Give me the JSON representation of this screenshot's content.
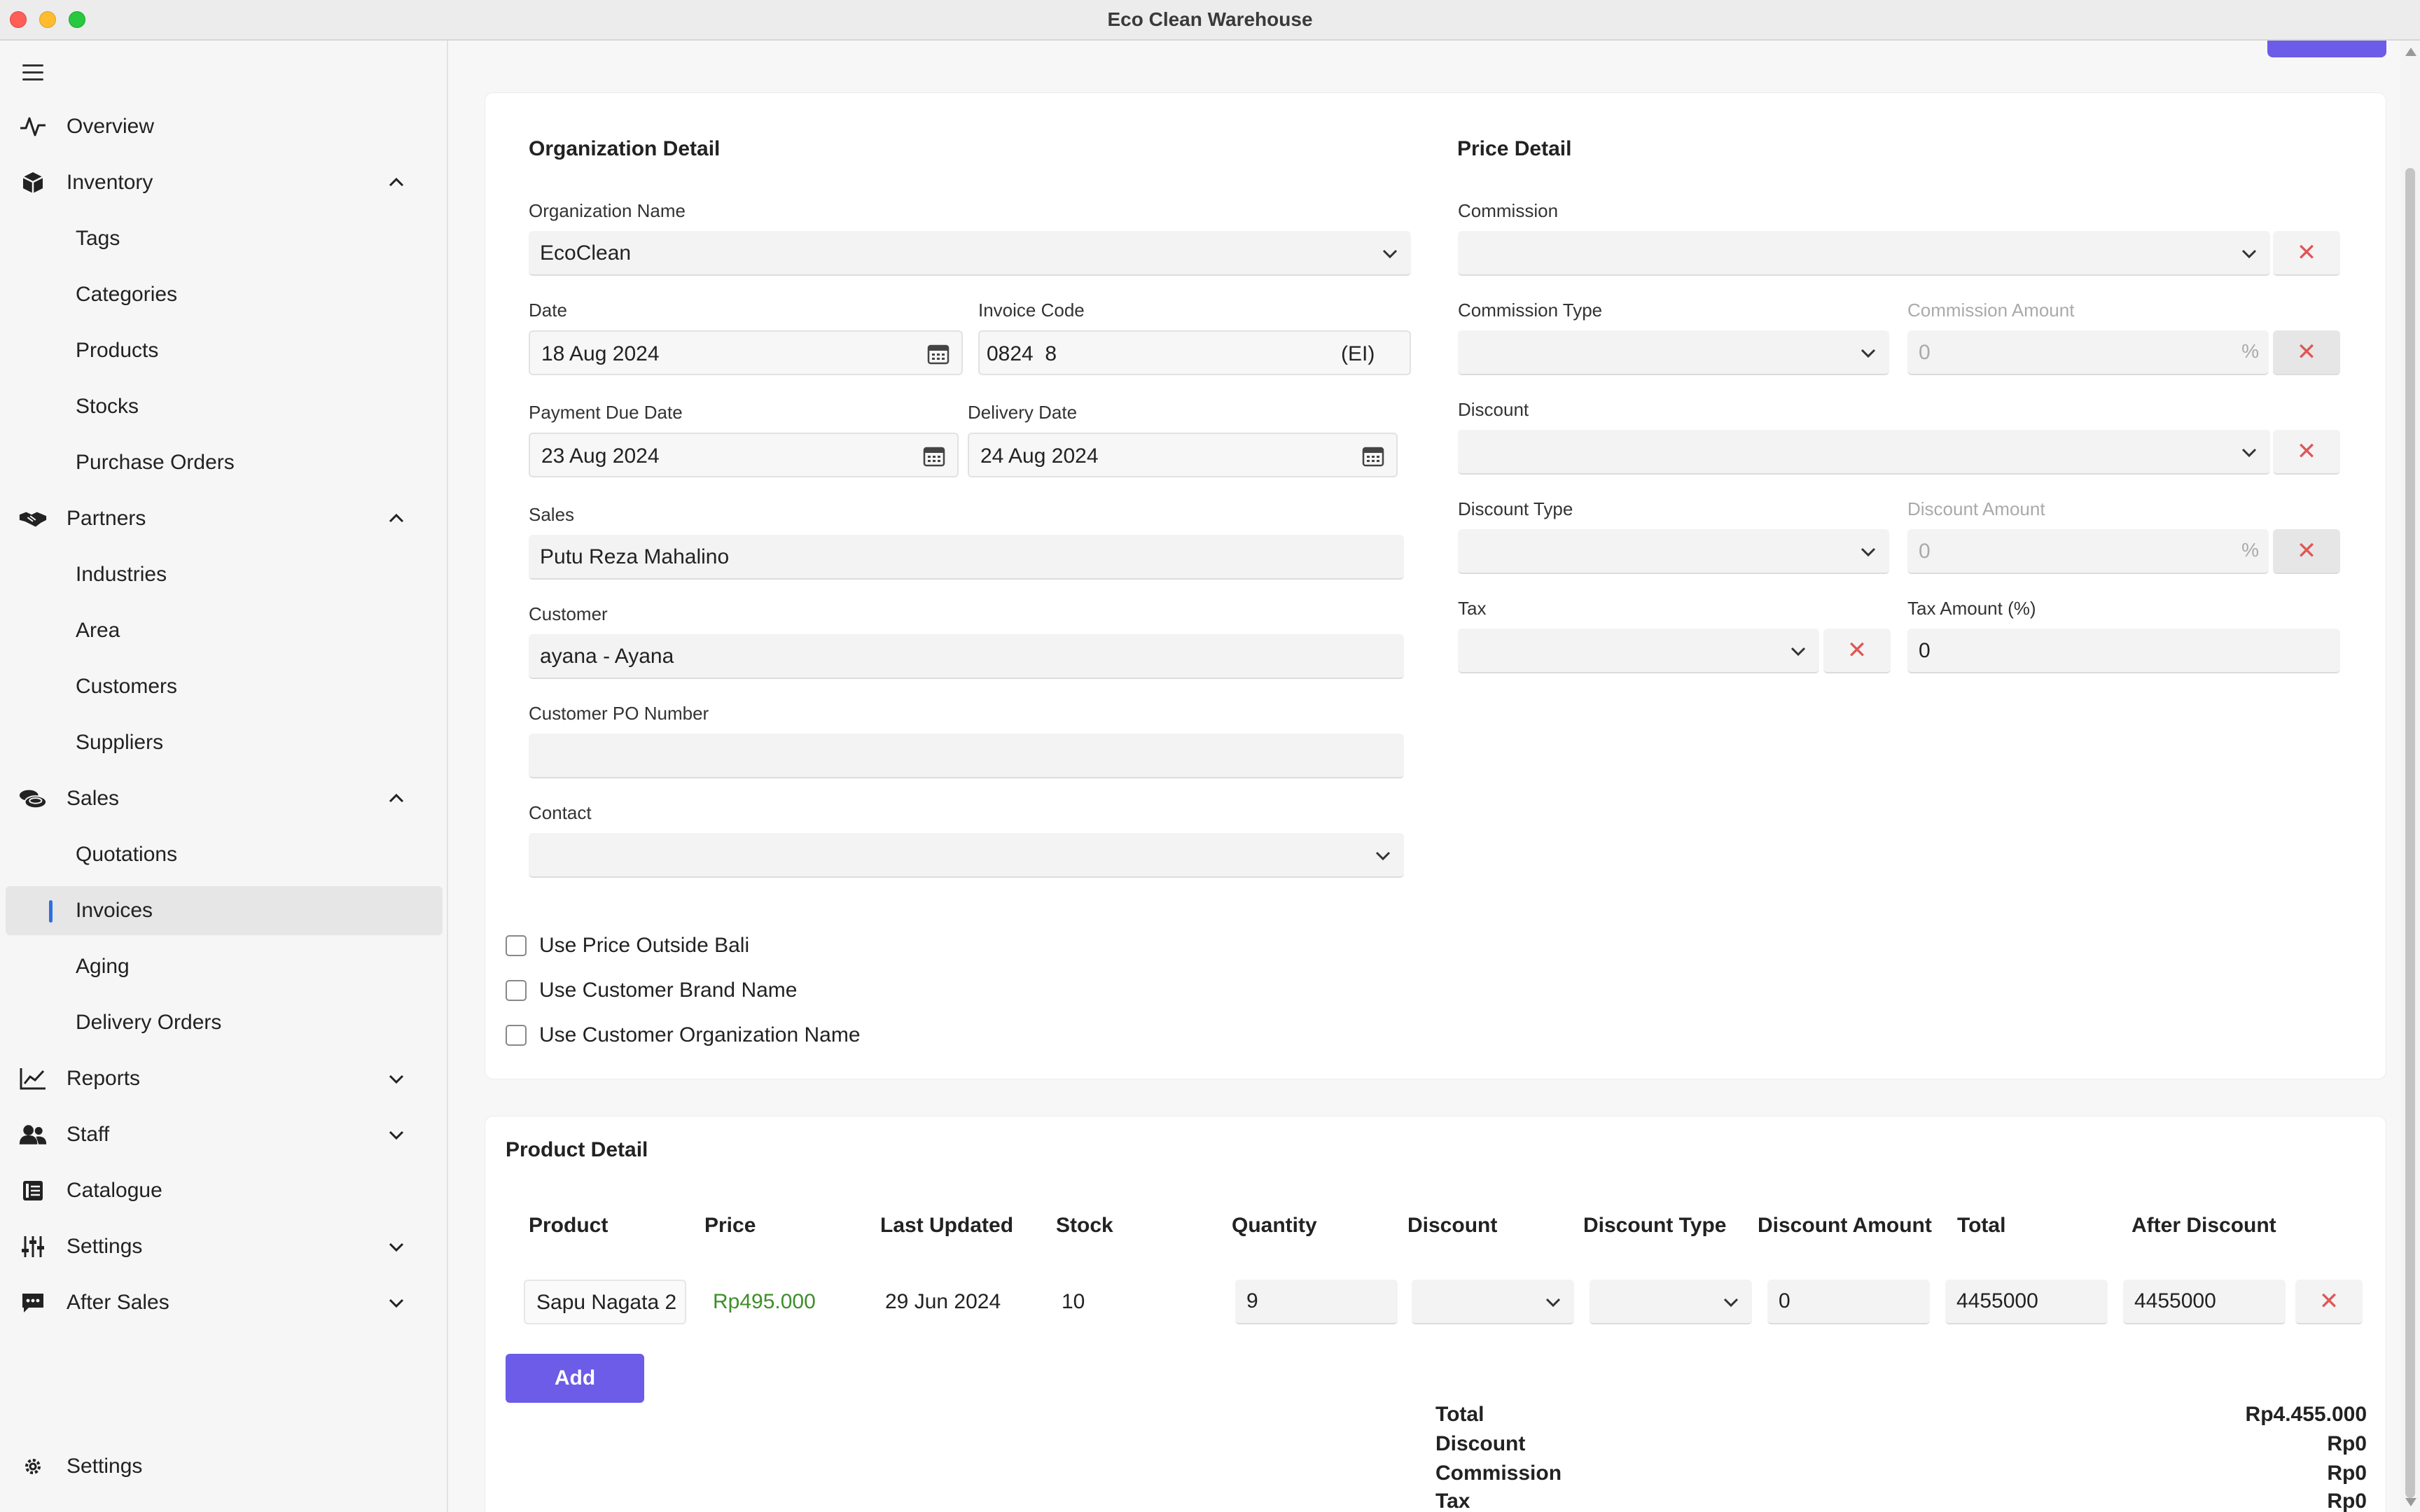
{
  "window": {
    "title": "Eco Clean Warehouse"
  },
  "sidebar": {
    "items": [
      {
        "label": "Overview",
        "icon": "activity-icon"
      },
      {
        "label": "Inventory",
        "icon": "box-icon"
      },
      {
        "label": "Tags"
      },
      {
        "label": "Categories"
      },
      {
        "label": "Products"
      },
      {
        "label": "Stocks"
      },
      {
        "label": "Purchase Orders"
      },
      {
        "label": "Partners",
        "icon": "handshake-icon"
      },
      {
        "label": "Industries"
      },
      {
        "label": "Area"
      },
      {
        "label": "Customers"
      },
      {
        "label": "Suppliers"
      },
      {
        "label": "Sales",
        "icon": "coins-icon"
      },
      {
        "label": "Quotations"
      },
      {
        "label": "Invoices"
      },
      {
        "label": "Aging"
      },
      {
        "label": "Delivery Orders"
      },
      {
        "label": "Reports",
        "icon": "chart-line-icon"
      },
      {
        "label": "Staff",
        "icon": "users-icon"
      },
      {
        "label": "Catalogue",
        "icon": "catalogue-icon"
      },
      {
        "label": "Settings",
        "icon": "sliders-icon"
      },
      {
        "label": "After Sales",
        "icon": "chat-icon"
      }
    ],
    "footer_settings": "Settings",
    "active": "Invoices"
  },
  "org": {
    "title": "Organization Detail",
    "org_name_label": "Organization Name",
    "org_name_value": "EcoClean",
    "date_label": "Date",
    "date_value": "18 Aug 2024",
    "invoice_code_label": "Invoice Code",
    "invoice_code_value": "0824  8",
    "invoice_code_suffix": "(EI)",
    "payment_due_label": "Payment Due Date",
    "payment_due_value": "23 Aug 2024",
    "delivery_date_label": "Delivery Date",
    "delivery_date_value": "24 Aug 2024",
    "sales_label": "Sales",
    "sales_value": "Putu Reza Mahalino",
    "customer_label": "Customer",
    "customer_value": "ayana - Ayana",
    "po_label": "Customer PO Number",
    "po_value": "",
    "contact_label": "Contact",
    "contact_value": ""
  },
  "price": {
    "title": "Price Detail",
    "commission_label": "Commission",
    "commission_type_label": "Commission Type",
    "commission_amount_label": "Commission Amount",
    "commission_amount_value": "0",
    "discount_label": "Discount",
    "discount_type_label": "Discount Type",
    "discount_amount_label": "Discount Amount",
    "discount_amount_value": "0",
    "tax_label": "Tax",
    "tax_amount_label": "Tax Amount (%)",
    "tax_amount_value": "0",
    "percent": "%"
  },
  "options": {
    "outside_bali": "Use Price Outside Bali",
    "brand_name": "Use Customer Brand Name",
    "org_name": "Use Customer Organization Name"
  },
  "products": {
    "title": "Product Detail",
    "headers": {
      "product": "Product",
      "price": "Price",
      "last_updated": "Last Updated",
      "stock": "Stock",
      "quantity": "Quantity",
      "discount": "Discount",
      "discount_type": "Discount Type",
      "discount_amount": "Discount Amount",
      "total": "Total",
      "after_discount": "After Discount"
    },
    "row": {
      "product": "Sapu Nagata 2",
      "price": "Rp495.000",
      "last_updated": "29 Jun 2024",
      "stock": "10",
      "quantity": "9",
      "discount_amount": "0",
      "total": "4455000",
      "after_discount": "4455000"
    },
    "add_label": "Add"
  },
  "summary": {
    "total_label": "Total",
    "total_value": "Rp4.455.000",
    "discount_label": "Discount",
    "discount_value": "Rp0",
    "commission_label": "Commission",
    "commission_value": "Rp0",
    "tax_label": "Tax",
    "tax_value": "Rp0"
  },
  "colors": {
    "accent": "#6c5ce7",
    "danger": "#e05555",
    "price": "#3e8e2b",
    "active_bar": "#2f6fe0"
  }
}
